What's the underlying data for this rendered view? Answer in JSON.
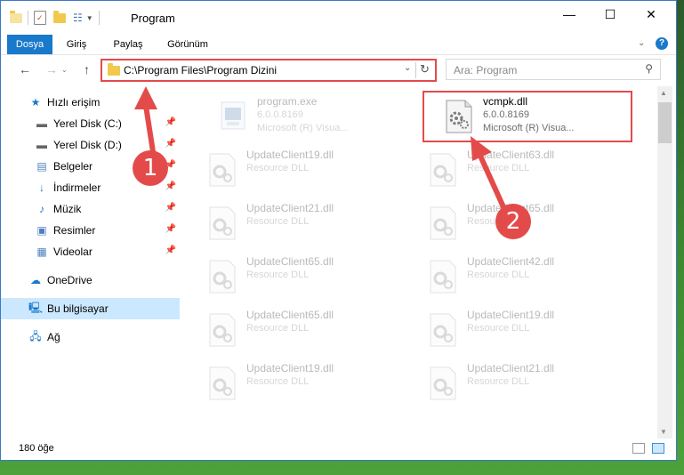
{
  "window": {
    "title": "Program",
    "controls": {
      "minimize": "—",
      "maximize": "☐",
      "close": "✕"
    }
  },
  "ribbon": {
    "tabs": [
      {
        "label": "Dosya",
        "active": true
      },
      {
        "label": "Giriş"
      },
      {
        "label": "Paylaş"
      },
      {
        "label": "Görünüm"
      }
    ],
    "expand_icon": "chevron-down-icon",
    "help_icon": "help-icon"
  },
  "navigation": {
    "back": "←",
    "forward": "→",
    "up": "↑",
    "address": "C:\\Program Files\\Program Dizini",
    "refresh": "↻",
    "search_placeholder": "Ara: Program"
  },
  "sidebar": {
    "items": [
      {
        "label": "Hızlı erişim",
        "icon": "star-icon",
        "pinned": false
      },
      {
        "label": "Yerel Disk (C:)",
        "icon": "drive-icon",
        "pinned": true
      },
      {
        "label": "Yerel Disk (D:)",
        "icon": "drive-icon",
        "pinned": true
      },
      {
        "label": "Belgeler",
        "icon": "document-icon",
        "pinned": true
      },
      {
        "label": "İndirmeler",
        "icon": "download-icon",
        "pinned": true
      },
      {
        "label": "Müzik",
        "icon": "music-icon",
        "pinned": true
      },
      {
        "label": "Resimler",
        "icon": "picture-icon",
        "pinned": true
      },
      {
        "label": "Videolar",
        "icon": "video-icon",
        "pinned": true
      },
      {
        "label": "OneDrive",
        "icon": "cloud-icon",
        "pinned": false
      },
      {
        "label": "Bu bilgisayar",
        "icon": "computer-icon",
        "pinned": false,
        "selected": true
      },
      {
        "label": "Ağ",
        "icon": "network-icon",
        "pinned": false
      }
    ]
  },
  "files": [
    {
      "name": "program.exe",
      "line2": "6.0.0.8169",
      "line3": "Microsoft (R) Visua...",
      "faded": true,
      "type": "exe"
    },
    {
      "name": "vcmpk.dll",
      "line2": "6.0.0.8169",
      "line3": "Microsoft (R) Visua...",
      "faded": false,
      "type": "dll",
      "highlighted": true
    },
    {
      "name": "UpdateClient19.dll",
      "line2": "Resource DLL",
      "faded": true,
      "type": "dll"
    },
    {
      "name": "UpdateClient63.dll",
      "line2": "Resource DLL",
      "faded": true,
      "type": "dll"
    },
    {
      "name": "UpdateClient21.dll",
      "line2": "Resource DLL",
      "faded": true,
      "type": "dll"
    },
    {
      "name": "UpdateClient65.dll",
      "line2": "Resource DLL",
      "faded": true,
      "type": "dll"
    },
    {
      "name": "UpdateClient65.dll",
      "line2": "Resource DLL",
      "faded": true,
      "type": "dll"
    },
    {
      "name": "UpdateClient42.dll",
      "line2": "Resource DLL",
      "faded": true,
      "type": "dll"
    },
    {
      "name": "UpdateClient65.dll",
      "line2": "Resource DLL",
      "faded": true,
      "type": "dll"
    },
    {
      "name": "UpdateClient19.dll",
      "line2": "Resource DLL",
      "faded": true,
      "type": "dll"
    },
    {
      "name": "UpdateClient19.dll",
      "line2": "Resource DLL",
      "faded": true,
      "type": "dll"
    },
    {
      "name": "UpdateClient21.dll",
      "line2": "Resource DLL",
      "faded": true,
      "type": "dll"
    }
  ],
  "status": {
    "item_count": "180 öğe"
  },
  "annotations": {
    "callout_1": "1",
    "callout_2": "2",
    "accent": "#e34b4b"
  }
}
